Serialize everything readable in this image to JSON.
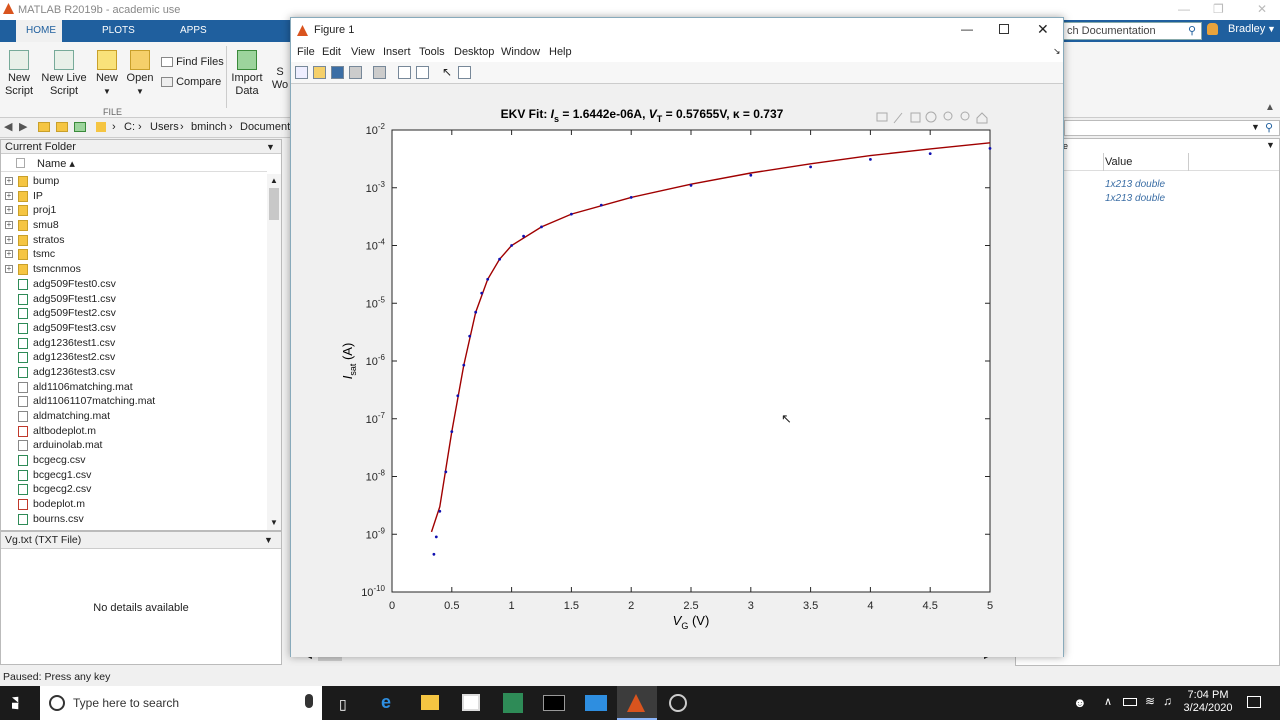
{
  "app": {
    "title": "MATLAB R2019b - academic use",
    "user": "Bradley",
    "search_placeholder": "ch Documentation"
  },
  "ribbon": {
    "tabs": [
      "HOME",
      "PLOTS",
      "APPS"
    ],
    "buttons": {
      "new_script": "New Script",
      "new_live_script": "New Live Script",
      "new": "New",
      "open": "Open",
      "find_files": "Find Files",
      "compare": "Compare",
      "import_data": "Import Data",
      "save_ws": "S Wo"
    },
    "file_group": "FILE"
  },
  "address": {
    "path": [
      "C:",
      "Users",
      "bminch",
      "Documents"
    ]
  },
  "current_folder": {
    "title": "Current Folder",
    "name_col": "Name ▴",
    "folders": [
      "bump",
      "IP",
      "proj1",
      "smu8",
      "stratos",
      "tsmc",
      "tsmcnmos"
    ],
    "files": [
      {
        "name": "adg509Ftest0.csv",
        "type": "csv"
      },
      {
        "name": "adg509Ftest1.csv",
        "type": "csv"
      },
      {
        "name": "adg509Ftest2.csv",
        "type": "csv"
      },
      {
        "name": "adg509Ftest3.csv",
        "type": "csv"
      },
      {
        "name": "adg1236test1.csv",
        "type": "csv"
      },
      {
        "name": "adg1236test2.csv",
        "type": "csv"
      },
      {
        "name": "adg1236test3.csv",
        "type": "csv"
      },
      {
        "name": "ald1106matching.mat",
        "type": "mat"
      },
      {
        "name": "ald11061107matching.mat",
        "type": "mat"
      },
      {
        "name": "aldmatching.mat",
        "type": "mat"
      },
      {
        "name": "altbodeplot.m",
        "type": "m"
      },
      {
        "name": "arduinolab.mat",
        "type": "mat"
      },
      {
        "name": "bcgecg.csv",
        "type": "csv"
      },
      {
        "name": "bcgecg1.csv",
        "type": "csv"
      },
      {
        "name": "bcgecg2.csv",
        "type": "csv"
      },
      {
        "name": "bodeplot.m",
        "type": "m"
      },
      {
        "name": "bourns.csv",
        "type": "csv"
      }
    ]
  },
  "details": {
    "file_title": "Vg.txt  (TXT File)",
    "message": "No details available"
  },
  "workspace": {
    "value_col": "Value",
    "col_frag": "e",
    "values": [
      "1x213 double",
      "1x213 double"
    ]
  },
  "status": {
    "text": "Paused: Press any key"
  },
  "taskbar": {
    "search": "Type here to search",
    "time": "7:04 PM",
    "date": "3/24/2020"
  },
  "figure": {
    "title": "Figure 1",
    "menus": [
      "File",
      "Edit",
      "View",
      "Insert",
      "Tools",
      "Desktop",
      "Window",
      "Help"
    ],
    "plot_title": {
      "prefix": "EKV Fit:  ",
      "is_sym": "I",
      "is_sub": "s",
      "is_val": " = 1.6442e-06A,  ",
      "vt_sym": "V",
      "vt_sub": "T",
      "vt_val": " = 0.57655V, ",
      "kappa": "κ = 0.737"
    },
    "xlabel": {
      "sym": "V",
      "sub": "G",
      "unit": " (V)"
    },
    "ylabel": {
      "sym": "I",
      "sub": "sat",
      "unit": " (A)"
    }
  },
  "chart_data": {
    "type": "scatter",
    "yscale": "log",
    "xlim": [
      0,
      5
    ],
    "ylim": [
      1e-10,
      0.01
    ],
    "x_ticks": [
      "0",
      "0.5",
      "1",
      "1.5",
      "2",
      "2.5",
      "3",
      "3.5",
      "4",
      "4.5",
      "5"
    ],
    "y_ticks_exp": [
      "-10",
      "-9",
      "-8",
      "-7",
      "-6",
      "-5",
      "-4",
      "-3",
      "-2"
    ],
    "colors": {
      "measured": "#1010b0",
      "fit": "#a00000"
    },
    "series": [
      {
        "marker": "dot",
        "x": [
          0.35,
          0.37,
          0.4,
          0.45,
          0.5,
          0.55,
          0.6,
          0.65,
          0.7,
          0.75,
          0.8,
          0.9,
          1.0,
          1.1,
          1.25,
          1.5,
          1.75,
          2.0,
          2.5,
          3.0,
          3.5,
          4.0,
          4.5,
          5.0
        ],
        "y": [
          4.5e-10,
          9e-10,
          2.5e-09,
          1.2e-08,
          6e-08,
          2.5e-07,
          8.5e-07,
          2.7e-06,
          7e-06,
          1.5e-05,
          2.6e-05,
          5.8e-05,
          0.0001,
          0.000145,
          0.00021,
          0.00035,
          0.0005,
          0.00068,
          0.0011,
          0.00165,
          0.0023,
          0.0031,
          0.0039,
          0.0048
        ]
      },
      {
        "marker": "line",
        "x": [
          0.33,
          0.4,
          0.5,
          0.6,
          0.7,
          0.8,
          0.9,
          1.0,
          1.25,
          1.5,
          2.0,
          2.5,
          3.0,
          3.5,
          4.0,
          4.5,
          5.0
        ],
        "y": [
          1.1e-09,
          3e-09,
          6e-08,
          8.5e-07,
          7e-06,
          2.6e-05,
          5.8e-05,
          0.0001,
          0.00021,
          0.00035,
          0.00068,
          0.00115,
          0.0018,
          0.0026,
          0.0036,
          0.0047,
          0.006
        ]
      }
    ]
  }
}
